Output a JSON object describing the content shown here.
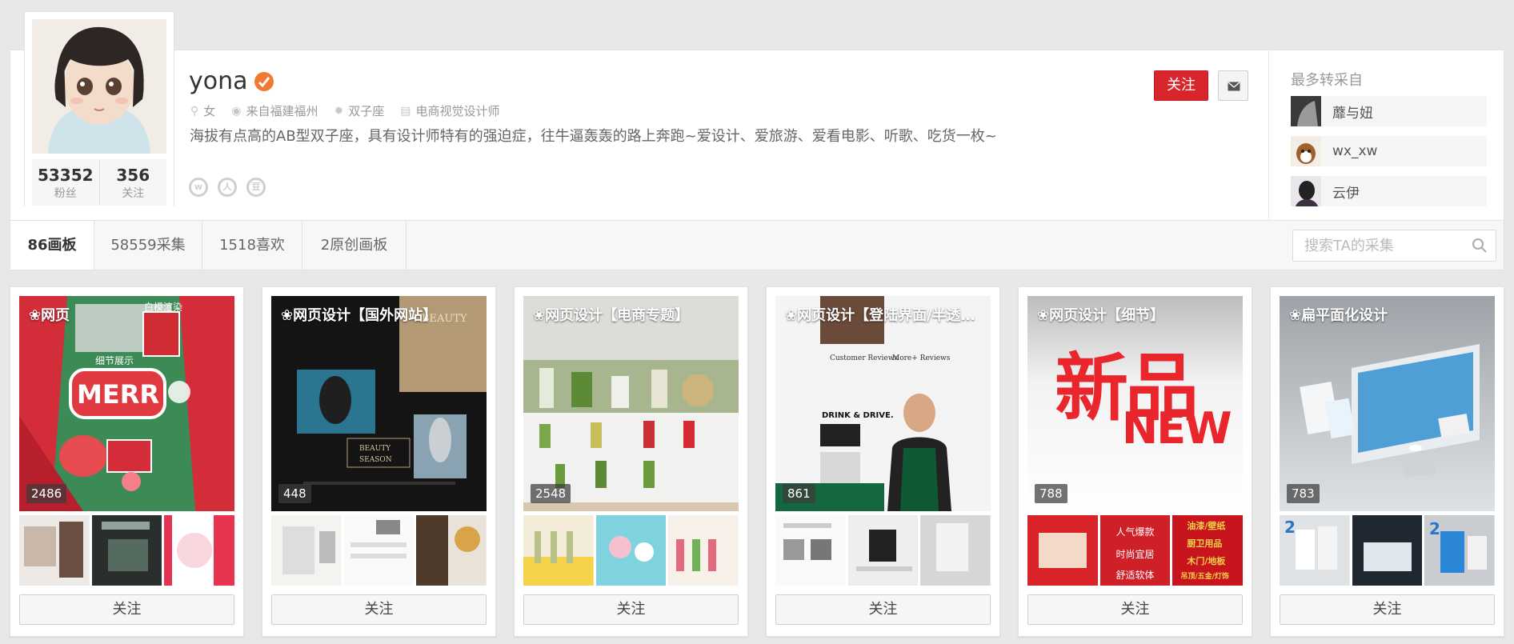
{
  "profile": {
    "name": "yona",
    "gender": "女",
    "location": "来自福建福州",
    "zodiac": "双子座",
    "job": "电商视觉设计师",
    "bio": "海拔有点高的AB型双子座，具有设计师特有的强迫症，往牛逼轰轰的路上奔跑~爱设计、爱旅游、爱看电影、听歌、吃货一枚~",
    "followers_count": "53352",
    "followers_label": "粉丝",
    "following_count": "356",
    "following_label": "关注",
    "follow_button": "关注",
    "social_icons": [
      "weibo-icon",
      "renren-icon",
      "douban-icon"
    ]
  },
  "sources": {
    "title": "最多转采自",
    "items": [
      {
        "name": "蘼与妞"
      },
      {
        "name": "wx_xw"
      },
      {
        "name": "云伊"
      }
    ]
  },
  "tabs": [
    {
      "label": "86画板",
      "active": true
    },
    {
      "label": "58559采集",
      "active": false
    },
    {
      "label": "1518喜欢",
      "active": false
    },
    {
      "label": "2原创画板",
      "active": false
    }
  ],
  "search": {
    "placeholder": "搜索TA的采集"
  },
  "boards": [
    {
      "title": "❀网页",
      "count": "2486",
      "follow": "关注",
      "cover_text": [
        "白模渲染",
        "细节展示",
        "MERR"
      ]
    },
    {
      "title": "❀网页设计【国外网站】",
      "count": "448",
      "follow": "关注",
      "cover_text": [
        "BEAUTY",
        "SEASON"
      ]
    },
    {
      "title": "❀网页设计【电商专题】",
      "count": "2548",
      "follow": "关注"
    },
    {
      "title": "❀网页设计【登陆界面/半透明…",
      "count": "861",
      "follow": "关注",
      "cover_text": [
        "Customer Reviews",
        "More+ Reviews",
        "DRINK & DRIVE."
      ]
    },
    {
      "title": "❀网页设计【细节】",
      "count": "788",
      "follow": "关注",
      "cover_text": [
        "新品",
        "NEW"
      ],
      "thumb_text": [
        "人气爆款",
        "时尚宜居",
        "舒适软体",
        "油漆/壁纸",
        "厨卫用品",
        "木门/地板",
        "吊顶/五金/灯饰"
      ]
    },
    {
      "title": "❀扁平面化设计",
      "count": "783",
      "follow": "关注"
    }
  ],
  "colors": {
    "accent_red": "#d9262d",
    "verify_orange": "#f07a31",
    "page_bg": "#e8e8e8"
  }
}
